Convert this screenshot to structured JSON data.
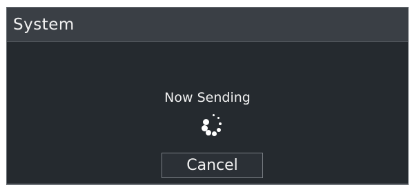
{
  "dialog": {
    "title": "System",
    "status_text": "Now Sending",
    "spinner_icon": "loading-spinner-icon",
    "cancel_label": "Cancel"
  },
  "colors": {
    "panel_bg": "#252a2f",
    "titlebar_bg": "#3a3f45",
    "text": "#f2f2f2"
  }
}
